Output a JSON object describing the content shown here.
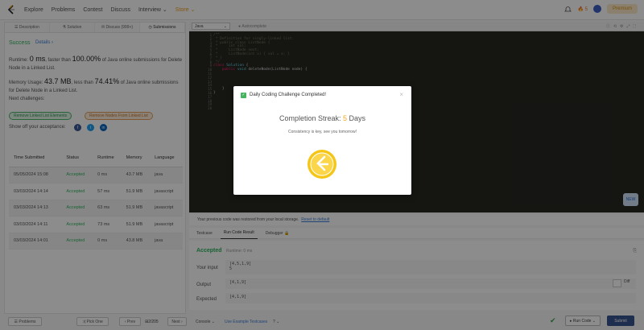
{
  "nav": {
    "items": [
      "Explore",
      "Problems",
      "Contest",
      "Discuss",
      "Interview",
      "Store"
    ],
    "streak_count": "5",
    "premium": "Premium"
  },
  "left_tabs": [
    "Description",
    "Solution",
    "Discuss (999+)",
    "Submissions"
  ],
  "result": {
    "status": "Success",
    "details": "Details",
    "runtime_prefix": "Runtime: ",
    "runtime_value": "0 ms",
    "runtime_mid": ", faster than ",
    "runtime_pct": "100.00%",
    "runtime_suffix": " of Java online submissions for Delete Node in a Linked List.",
    "memory_prefix": "Memory Usage: ",
    "memory_value": "43.7 MB",
    "memory_mid": ", less than ",
    "memory_pct": "74.41%",
    "memory_suffix": " of Java online submissions for Delete Node in a Linked List.",
    "next_label": "Next challenges:",
    "next_1": "Remove Linked List Elements",
    "next_2": "Remove Nodes From Linked List",
    "share_label": "Show off your acceptance:"
  },
  "table": {
    "headers": [
      "Time Submitted",
      "Status",
      "Runtime",
      "Memory",
      "Language"
    ],
    "rows": [
      [
        "05/05/2024 15:08",
        "Accepted",
        "0 ms",
        "43.7 MB",
        "java"
      ],
      [
        "03/03/2024 14:14",
        "Accepted",
        "57 ms",
        "51.9 MB",
        "javascript"
      ],
      [
        "03/03/2024 14:13",
        "Accepted",
        "63 ms",
        "51.9 MB",
        "javascript"
      ],
      [
        "03/03/2024 14:11",
        "Accepted",
        "73 ms",
        "51.9 MB",
        "javascript"
      ],
      [
        "03/03/2024 14:01",
        "Accepted",
        "0 ms",
        "43.8 MB",
        "java"
      ]
    ]
  },
  "left_footer": {
    "problems": "Problems",
    "pick_one": "Pick One",
    "prev": "Prev",
    "page": "2/205",
    "next": "Next"
  },
  "editor": {
    "language": "Java",
    "autocomplete": "Autocomplete",
    "line_numbers": [
      "1",
      "2",
      "3",
      "4",
      "5",
      "6",
      "7",
      "8",
      "9",
      "10",
      "11",
      "12",
      "13",
      "14",
      "15",
      "16",
      "17",
      "18",
      "19",
      "20"
    ],
    "new_badge": "NEW"
  },
  "restore": {
    "text": "Your previous code was restored from your local storage.",
    "link": "Reset to default"
  },
  "result_tabs": [
    "Testcase",
    "Run Code Result",
    "Debugger"
  ],
  "run_result": {
    "status": "Accepted",
    "runtime": "Runtime: 0 ms",
    "input_label": "Your input",
    "input_value": "[4,5,1,9]\n5",
    "output_label": "Output",
    "output_value": "[4,1,9]",
    "expected_label": "Expected",
    "expected_value": "[4,1,9]",
    "diff": "Diff"
  },
  "bottom": {
    "console": "Console",
    "use_example": "Use Example Testcases",
    "run_code": "Run Code",
    "submit": "Submit"
  },
  "modal": {
    "title": "Daily Coding Challenge Completed!",
    "streak_label": "Completion Streak: ",
    "streak_value": "5",
    "streak_unit": " Days",
    "message": "Consistency is key, see you tomorrow!"
  },
  "colors": {
    "accent": "#2db55d",
    "brand_orange": "#f1a51c",
    "submit": "#38548f"
  }
}
